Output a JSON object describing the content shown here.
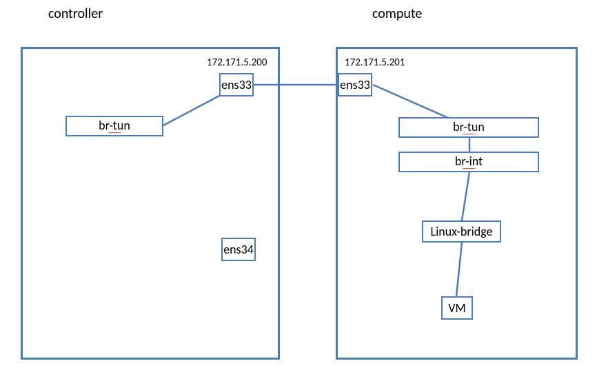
{
  "chart_data": {
    "type": "diagram",
    "title": "",
    "hosts": [
      {
        "name": "controller",
        "interfaces": [
          {
            "name": "ens33",
            "ip": "172.171.5.200"
          },
          {
            "name": "ens34"
          }
        ],
        "components": [
          "br-tun"
        ],
        "internal_links": [
          [
            "br-tun",
            "ens33"
          ]
        ]
      },
      {
        "name": "compute",
        "interfaces": [
          {
            "name": "ens33",
            "ip": "172.171.5.201"
          }
        ],
        "components": [
          "br-tun",
          "br-int",
          "Linux-bridge",
          "VM"
        ],
        "internal_links": [
          [
            "ens33",
            "br-tun"
          ],
          [
            "br-tun",
            "br-int"
          ],
          [
            "br-int",
            "Linux-bridge"
          ],
          [
            "Linux-bridge",
            "VM"
          ]
        ]
      }
    ],
    "external_links": [
      [
        "controller.ens33",
        "compute.ens33"
      ]
    ]
  },
  "labels": {
    "controller_title": "controller",
    "compute_title": "compute",
    "controller_ip": "172.171.5.200",
    "compute_ip": "172.171.5.201",
    "controller_ens33": "ens33",
    "controller_ens34": "ens34",
    "controller_brtun": "br-tun",
    "compute_ens33": "ens33",
    "compute_brtun": "br-tun",
    "compute_brint": "br-int",
    "compute_linuxbridge": "Linux-bridge",
    "compute_vm": "VM"
  }
}
